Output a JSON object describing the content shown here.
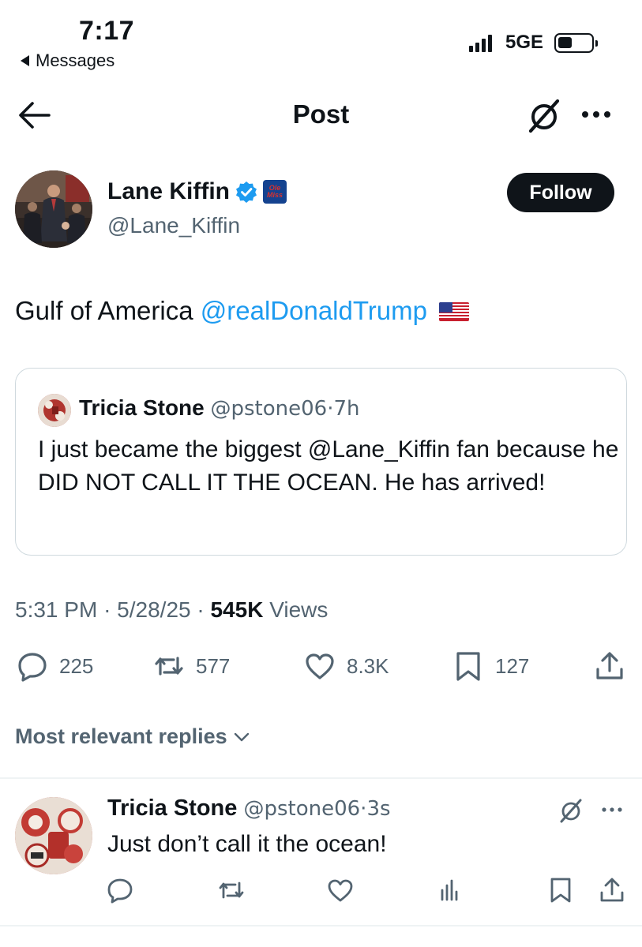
{
  "status_bar": {
    "time": "7:17",
    "back_app": "Messages",
    "network": "5GE"
  },
  "header": {
    "title": "Post",
    "icons": [
      "back-arrow-icon",
      "grok-icon",
      "more-icon"
    ]
  },
  "post": {
    "author_name": "Lane Kiffin",
    "author_handle": "@Lane_Kiffin",
    "follow_label": "Follow",
    "affiliation_badge": "Ole Miss",
    "text_plain": "Gulf of America ",
    "text_mention": "@realDonaldTrump",
    "flag": "us-flag-emoji",
    "quote": {
      "name": "Tricia Stone",
      "handle": "@pstone06",
      "time": "7h",
      "text": "I just became the biggest @Lane_Kiffin fan because he DID NOT CALL IT THE OCEAN.  He has arrived!"
    },
    "time": "5:31 PM",
    "date": "5/28/25",
    "views_count": "545K",
    "views_label": "Views",
    "stats": {
      "replies": "225",
      "reposts": "577",
      "likes": "8.3K",
      "bookmarks": "127"
    }
  },
  "replies_sort": "Most relevant replies",
  "reply": {
    "name": "Tricia Stone",
    "handle": "@pstone06",
    "time": "3s",
    "text": "Just don’t call it the ocean!"
  },
  "colors": {
    "accent": "#1d9bf0",
    "text": "#0f1419",
    "secondary": "#536471",
    "border": "#cfd9de"
  }
}
